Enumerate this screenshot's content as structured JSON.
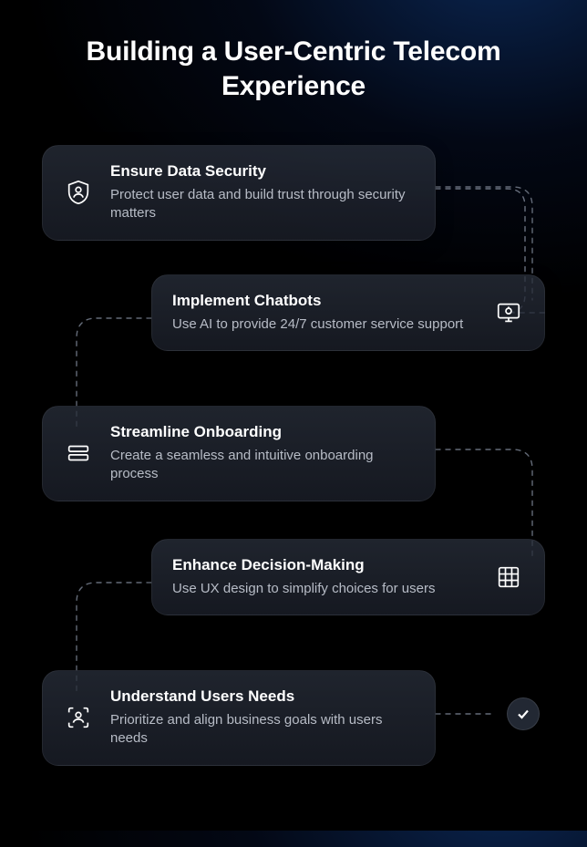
{
  "title": "Building a User-Centric Telecom Experience",
  "cards": [
    {
      "heading": "Ensure Data Security",
      "desc": "Protect user data and build trust through security matters",
      "icon": "shield-user"
    },
    {
      "heading": "Implement Chatbots",
      "desc": "Use AI to provide 24/7 customer service support",
      "icon": "chatbot-screen"
    },
    {
      "heading": "Streamline Onboarding",
      "desc": "Create a seamless and intuitive onboarding process",
      "icon": "rows"
    },
    {
      "heading": "Enhance Decision-Making",
      "desc": "Use UX design to simplify choices for users",
      "icon": "grid"
    },
    {
      "heading": "Understand Users Needs",
      "desc": "Prioritize and align business goals with users needs",
      "icon": "user-focus"
    }
  ]
}
